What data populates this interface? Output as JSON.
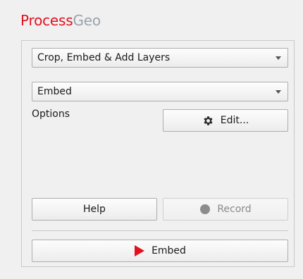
{
  "app": {
    "title_brand": "Process",
    "title_rest": "Geo"
  },
  "workflow": {
    "mode_select": "Crop, Embed & Add Layers",
    "step_select": "Embed"
  },
  "options": {
    "label": "Options",
    "edit_button": "Edit..."
  },
  "actions": {
    "help_button": "Help",
    "record_button": "Record",
    "run_button": "Embed"
  },
  "colors": {
    "brand": "#e3101e",
    "play": "#e3101e",
    "record_dot": "#8c8c8c"
  },
  "icons": {
    "edit": "gear-icon",
    "record": "record-icon",
    "run": "play-icon"
  }
}
